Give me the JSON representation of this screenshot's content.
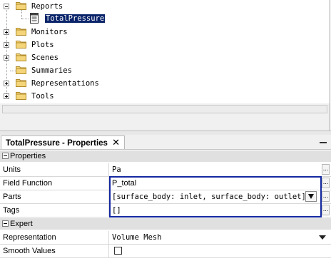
{
  "tree": {
    "items": [
      {
        "label": "Reports",
        "expander": "minus",
        "icon": "folder-icon"
      },
      {
        "label": "TotalPressure",
        "expander": "none",
        "icon": "report-icon",
        "selected": true
      },
      {
        "label": "Monitors",
        "expander": "plus",
        "icon": "folder-icon"
      },
      {
        "label": "Plots",
        "expander": "plus",
        "icon": "folder-icon"
      },
      {
        "label": "Scenes",
        "expander": "plus",
        "icon": "folder-icon"
      },
      {
        "label": "Summaries",
        "expander": "none",
        "icon": "folder-icon"
      },
      {
        "label": "Representations",
        "expander": "plus",
        "icon": "folder-icon"
      },
      {
        "label": "Tools",
        "expander": "plus",
        "icon": "folder-icon"
      }
    ]
  },
  "properties": {
    "tab_title": "TotalPressure - Properties",
    "close_glyph": "✕",
    "sections": {
      "properties": {
        "title": "Properties",
        "rows": {
          "units": {
            "name": "Units",
            "value": "Pa"
          },
          "field_function": {
            "name": "Field Function",
            "value": "P_total"
          },
          "parts": {
            "name": "Parts",
            "value": "[surface_body: inlet, surface_body: outlet]"
          },
          "tags": {
            "name": "Tags",
            "value": "[]"
          }
        }
      },
      "expert": {
        "title": "Expert",
        "rows": {
          "representation": {
            "name": "Representation",
            "value": "Volume Mesh"
          },
          "smooth_values": {
            "name": "Smooth Values",
            "checked": false
          }
        }
      }
    },
    "ellipsis_glyph": "..."
  },
  "colors": {
    "selection": "#0a246a",
    "edit_highlight": "#1428a0",
    "section_bg": "#e0e0e0",
    "folder": "#f2c94c"
  }
}
